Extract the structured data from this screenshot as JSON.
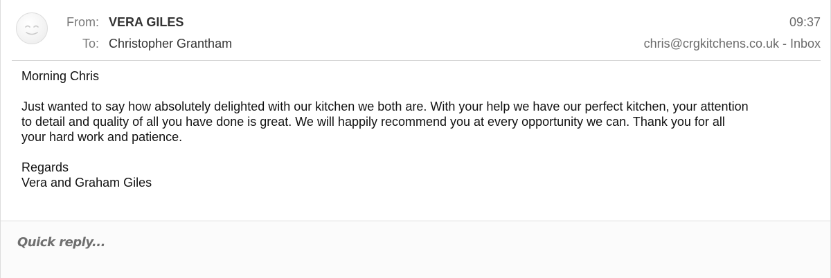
{
  "header": {
    "from_label": "From:",
    "from_name": "VERA GILES",
    "to_label": "To:",
    "to_name": "Christopher Grantham",
    "time": "09:37",
    "mailbox": "chris@crgkitchens.co.uk - Inbox",
    "avatar_icon": "smiley-face-icon"
  },
  "message": {
    "greeting": "Morning Chris",
    "paragraph_line1": "Just wanted to say how absolutely delighted with our kitchen we both are. With your help we have our perfect kitchen, your attention",
    "paragraph_line2": "to detail and quality of all you have done is great. We will happily recommend you at every opportunity we can. Thank you for all",
    "paragraph_line3": "your hard work and patience.",
    "signoff": "Regards",
    "signature": "Vera and Graham Giles"
  },
  "reply": {
    "placeholder": "Quick reply..."
  },
  "colors": {
    "label": "#7a7a7a",
    "name": "#333333",
    "meta": "#6b6b6b",
    "body_text": "#111111",
    "divider": "#d6d6d6"
  }
}
